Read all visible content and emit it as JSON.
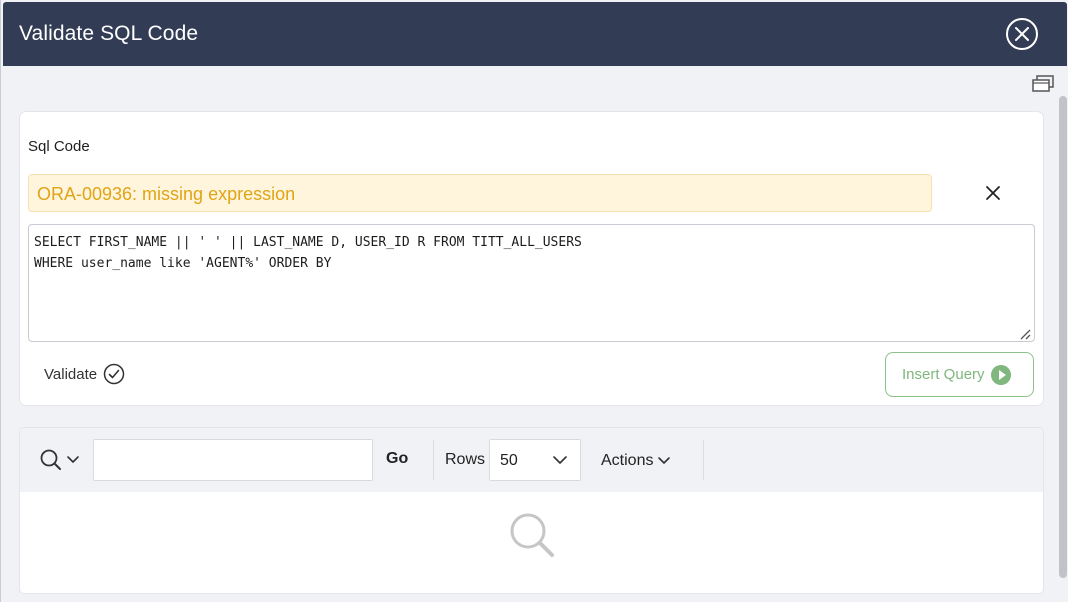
{
  "dialog": {
    "title": "Validate SQL Code"
  },
  "editor": {
    "label": "Sql Code",
    "error_message": "ORA-00936: missing expression",
    "sql_text": "SELECT FIRST_NAME || ' ' || LAST_NAME D, USER_ID R FROM TITT_ALL_USERS\nWHERE user_name like 'AGENT%' ORDER BY",
    "validate_label": "Validate",
    "insert_label": "Insert Query"
  },
  "report": {
    "search_value": "",
    "go_label": "Go",
    "rows_label": "Rows",
    "rows_value": "50",
    "actions_label": "Actions"
  },
  "colors": {
    "header": "#323d55",
    "error_text": "#e0a416",
    "error_bg": "#fff5dd",
    "insert_accent": "#7fb77e"
  },
  "icons": {
    "close": "close-circle-icon",
    "window": "window-restore-icon",
    "dismiss": "x-icon",
    "validate": "check-circle-icon",
    "insert": "play-circle-icon",
    "search": "search-icon",
    "chevron": "chevron-down-icon"
  }
}
